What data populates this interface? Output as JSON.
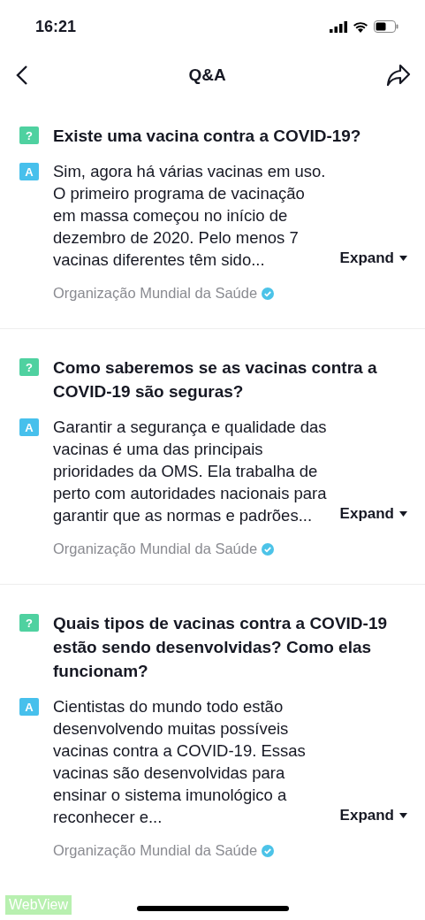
{
  "status_bar": {
    "time": "16:21"
  },
  "header": {
    "title": "Q&A"
  },
  "items": [
    {
      "question_badge": "?",
      "question": "Existe uma vacina contra a COVID-19?",
      "answer_badge": "A",
      "answer": "Sim, agora há várias vacinas em uso. O primeiro programa de vacinação em massa começou no início de dezembro de 2020. Pelo menos 7 vacinas diferentes têm sido...",
      "expand": "Expand",
      "source": "Organização Mundial da Saúde",
      "verified": true
    },
    {
      "question_badge": "?",
      "question": "Como saberemos se as vacinas contra a COVID-19 são seguras?",
      "answer_badge": "A",
      "answer": "Garantir a segurança e qualidade das vacinas é uma das principais prioridades da OMS. Ela trabalha de perto com autoridades nacionais para garantir que as normas e padrões...",
      "expand": "Expand",
      "source": "Organização Mundial da Saúde",
      "verified": true
    },
    {
      "question_badge": "?",
      "question": "Quais tipos de vacinas contra a COVID-19 estão sendo desenvolvidas? Como elas funcionam?",
      "answer_badge": "A",
      "answer": "Cientistas do mundo todo estão desenvolvendo muitas possíveis vacinas contra a COVID-19. Essas vacinas são desenvolvidas para ensinar o sistema imunológico a reconhecer e...",
      "expand": "Expand",
      "source": "Organização Mundial da Saúde",
      "verified": true
    }
  ],
  "debug_label": "WebView"
}
